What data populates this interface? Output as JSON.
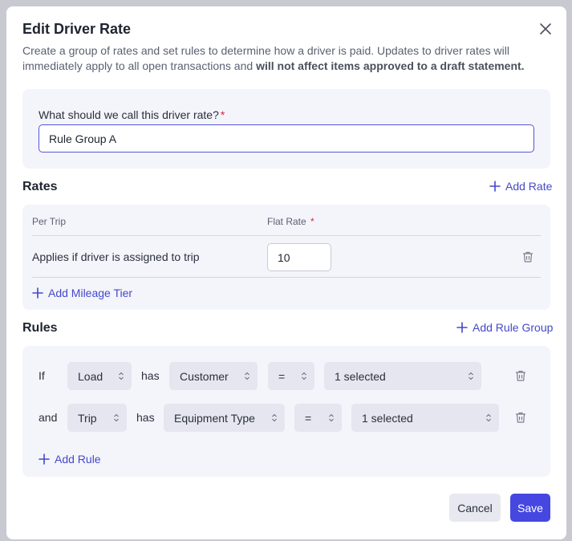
{
  "modal": {
    "title": "Edit Driver Rate",
    "description_main": "Create a group of rates and set rules to determine how a driver is paid. Updates to driver rates will immediately apply to all open transactions and ",
    "description_bold": "will not affect items approved to a draft statement."
  },
  "name_field": {
    "label": "What should we call this driver rate?",
    "required_mark": "*",
    "value": "Rule Group A"
  },
  "rates": {
    "title": "Rates",
    "add_label": "Add Rate",
    "col_per_trip": "Per Trip",
    "col_flat_rate": "Flat Rate",
    "required_mark": "*",
    "row_label": "Applies if driver is assigned to trip",
    "row_value": "10",
    "add_tier_label": "Add Mileage Tier"
  },
  "rules": {
    "title": "Rules",
    "add_group_label": "Add Rule Group",
    "rows": [
      {
        "connector": "If",
        "entity": "Load",
        "has": "has",
        "field": "Customer",
        "operator": "=",
        "value": "1 selected"
      },
      {
        "connector": "and",
        "entity": "Trip",
        "has": "has",
        "field": "Equipment Type",
        "operator": "=",
        "value": "1 selected"
      }
    ],
    "add_rule_label": "Add Rule"
  },
  "footer": {
    "cancel_label": "Cancel",
    "save_label": "Save"
  },
  "colors": {
    "accent": "#4547e0",
    "link": "#4449c8",
    "panel_bg": "#f4f4fb",
    "required": "#e0243a"
  },
  "icons": [
    "close-icon",
    "plus-icon",
    "trash-icon",
    "chevron-updown-icon"
  ]
}
